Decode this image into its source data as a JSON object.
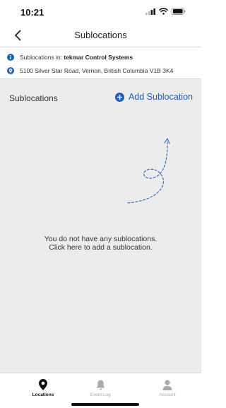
{
  "status_bar": {
    "time": "10:21"
  },
  "nav": {
    "title": "Sublocations"
  },
  "info": {
    "prefix": "Sublocations in: ",
    "location_name": "tekmar Control Systems",
    "address": "5100 Silver Star Road, Vernon, British Columbia V1B 3K4"
  },
  "section": {
    "title": "Sublocations",
    "add_label": "Add Sublocation"
  },
  "empty_state": {
    "line1": "You do not have any sublocations.",
    "line2": "Click here to add a sublocation."
  },
  "tabs": [
    {
      "label": "Locations",
      "icon": "location-pin-icon",
      "active": true
    },
    {
      "label": "Event Log",
      "icon": "bell-icon",
      "active": false
    },
    {
      "label": "Account",
      "icon": "person-icon",
      "active": false
    }
  ],
  "colors": {
    "accent": "#1f60b5",
    "background": "#ececec"
  }
}
